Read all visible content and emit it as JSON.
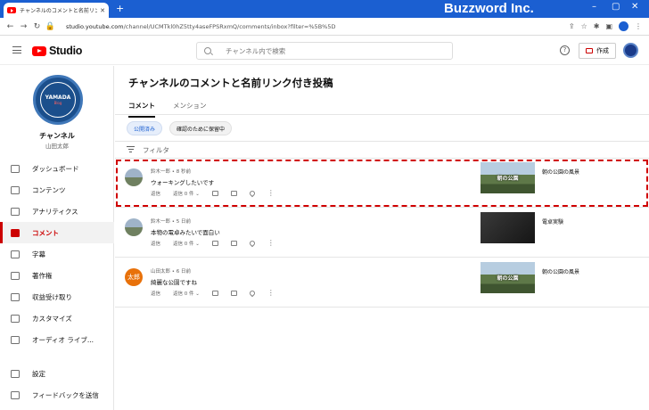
{
  "browser": {
    "tab_title": "チャンネルのコメントと名前リンク付き",
    "url_host": "studio.youtube.com",
    "url_path": "/channel/UCMTkl0hZ5tty4aseFPSRxmQ/comments/inbox?filter=%5B%5D",
    "brand": "Buzzword Inc."
  },
  "header": {
    "logo_text": "Studio",
    "search_placeholder": "チャンネル内で検索",
    "create_label": "作成",
    "help_symbol": "?"
  },
  "sidebar": {
    "avatar_text": "YAMADA",
    "avatar_sub": "Blog",
    "channel_label": "チャンネル",
    "channel_owner": "山田太郎",
    "items": [
      {
        "label": "ダッシュボード",
        "icon": "dashboard-icon"
      },
      {
        "label": "コンテンツ",
        "icon": "content-icon"
      },
      {
        "label": "アナリティクス",
        "icon": "analytics-icon"
      },
      {
        "label": "コメント",
        "icon": "comments-icon",
        "active": true
      },
      {
        "label": "字幕",
        "icon": "subtitles-icon"
      },
      {
        "label": "著作権",
        "icon": "copyright-icon"
      },
      {
        "label": "収益受け取り",
        "icon": "earn-icon"
      },
      {
        "label": "カスタマイズ",
        "icon": "customize-icon"
      },
      {
        "label": "オーディオ ライブ...",
        "icon": "audio-library-icon"
      }
    ],
    "bottom_items": [
      {
        "label": "設定",
        "icon": "settings-icon"
      },
      {
        "label": "フィードバックを送信",
        "icon": "feedback-icon"
      }
    ]
  },
  "main": {
    "title": "チャンネルのコメントと名前リンク付き投稿",
    "tabs": [
      {
        "label": "コメント",
        "active": true
      },
      {
        "label": "メンション",
        "active": false
      }
    ],
    "chips": [
      {
        "label": "公開済み",
        "active": true
      },
      {
        "label": "確認のために保留中",
        "active": false
      }
    ],
    "filter_label": "フィルタ",
    "comments": [
      {
        "author": "鈴木一郎",
        "time": "8 秒前",
        "text": "ウォーキングしたいです",
        "reply": "返信",
        "replies": "返信 0 件",
        "video_title": "朝の公園の風景",
        "thumb_text": "朝の公園",
        "avatar_initial": "",
        "highlight": true
      },
      {
        "author": "鈴木一郎",
        "time": "5 日前",
        "text": "本物の電卓みたいで面白い",
        "reply": "返信",
        "replies": "返信 0 件",
        "video_title": "電卓実験",
        "thumb_text": "",
        "avatar_initial": "",
        "highlight": false
      },
      {
        "author": "山田太郎",
        "time": "6 日前",
        "text": "綺麗な公園ですね",
        "reply": "返信",
        "replies": "返信 0 件",
        "video_title": "朝の公園の風景",
        "thumb_text": "朝の公園",
        "avatar_initial": "太郎",
        "highlight": false
      }
    ]
  },
  "colors": {
    "accent": "#cc0000",
    "browser_blue": "#1b5fd1",
    "chip_active": "#1b5fd1"
  }
}
